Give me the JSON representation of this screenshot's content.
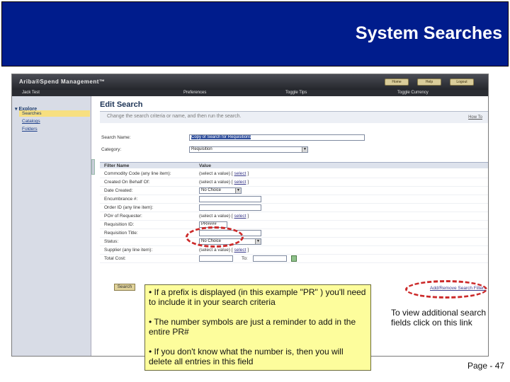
{
  "slide": {
    "title": "System Searches",
    "page_number": "Page - 47",
    "side_note": "To view additional search fields click on this link",
    "callout": [
      "• If a prefix is displayed (in this example \"PR\" ) you'll need to include it in your search criteria",
      "• The number symbols are just a reminder to add in the entire PR#",
      "• If you don't know what the number is, then you will delete all entries in this field"
    ],
    "colors": {
      "title_bg": "#001c8c",
      "callout_bg": "#fdfd9c",
      "highlight": "#cc2a2a"
    }
  },
  "app": {
    "logo": "Ariba®Spend Management™",
    "header_buttons": [
      "Home",
      "Help",
      "Logout"
    ],
    "user": "Jack Test",
    "nav": [
      "Preferences",
      "Toggle Tips",
      "Toggle Currency"
    ]
  },
  "sidebar": {
    "section": "Explore",
    "selected": "Searches",
    "links": [
      "Catalogs",
      "Folders"
    ]
  },
  "edit_search": {
    "title": "Edit Search",
    "instructions": "Change the search criteria or name, and then run the search.",
    "how_to": "How To",
    "search_name_label": "Search Name:",
    "search_name_value": "Copy of Search for Requisitions",
    "category_label": "Category:",
    "category_value": "Requisition",
    "filter_name_header": "Filter Name",
    "value_header": "Value",
    "search_button": "Search",
    "add_remove_link": "Add/Remove Search Filters"
  },
  "filters": [
    {
      "name": "Commodity Code (any line item):",
      "value": "(select a value)",
      "link": "select"
    },
    {
      "name": "Created On Behalf Of:",
      "value": "(select a value)",
      "link": "select"
    },
    {
      "name": "Date Created:",
      "dropdown": "No Choice"
    },
    {
      "name": "Encumbrance #:",
      "input": ""
    },
    {
      "name": "Order ID (any line item):",
      "input": ""
    },
    {
      "name": "PO# of Requester:",
      "value": "(select a value)",
      "link": "select"
    },
    {
      "name": "Requisition ID:",
      "input": "PR####"
    },
    {
      "name": "Requisition Title:",
      "input": ""
    },
    {
      "name": "Status:",
      "dropdown": "No Choice"
    },
    {
      "name": "Supplier (any line item):",
      "value": "(select a value)",
      "link": "select"
    },
    {
      "name": "Total Cost:",
      "input": "",
      "to_label": "To:"
    }
  ]
}
